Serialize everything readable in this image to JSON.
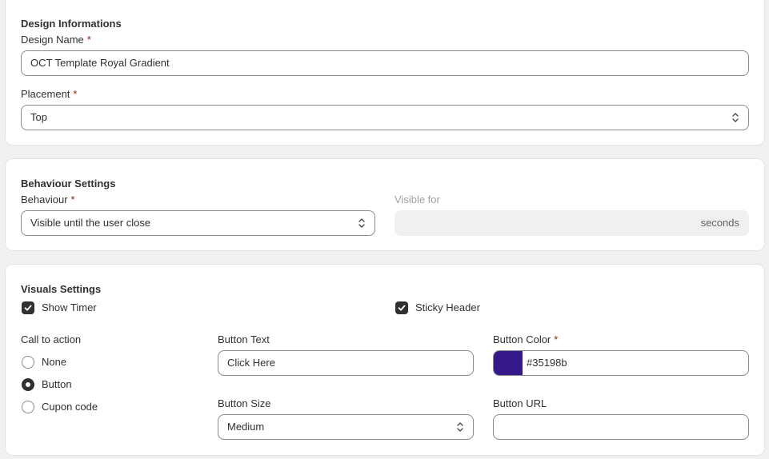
{
  "design": {
    "title": "Design Informations",
    "name_label": "Design Name",
    "name_value": "OCT Template Royal Gradient",
    "placement_label": "Placement",
    "placement_value": "Top",
    "required_mark": "*"
  },
  "behaviour": {
    "title": "Behaviour Settings",
    "behaviour_label": "Behaviour",
    "behaviour_value": "Visible until the user close",
    "visible_for_label": "Visible for",
    "visible_for_suffix": "seconds"
  },
  "visuals": {
    "title": "Visuals Settings",
    "show_timer_label": "Show Timer",
    "show_timer_checked": true,
    "sticky_header_label": "Sticky Header",
    "sticky_header_checked": true,
    "cta_label": "Call to action",
    "cta_options": [
      "None",
      "Button",
      "Cupon code"
    ],
    "cta_selected": "Button",
    "button_text_label": "Button Text",
    "button_text_value": "Click Here",
    "button_color_label": "Button Color",
    "button_color_value": "#35198b",
    "button_size_label": "Button Size",
    "button_size_value": "Medium",
    "button_url_label": "Button URL",
    "button_url_value": ""
  },
  "colors": {
    "button_color": "#35198b",
    "required": "#8e1f0b"
  }
}
